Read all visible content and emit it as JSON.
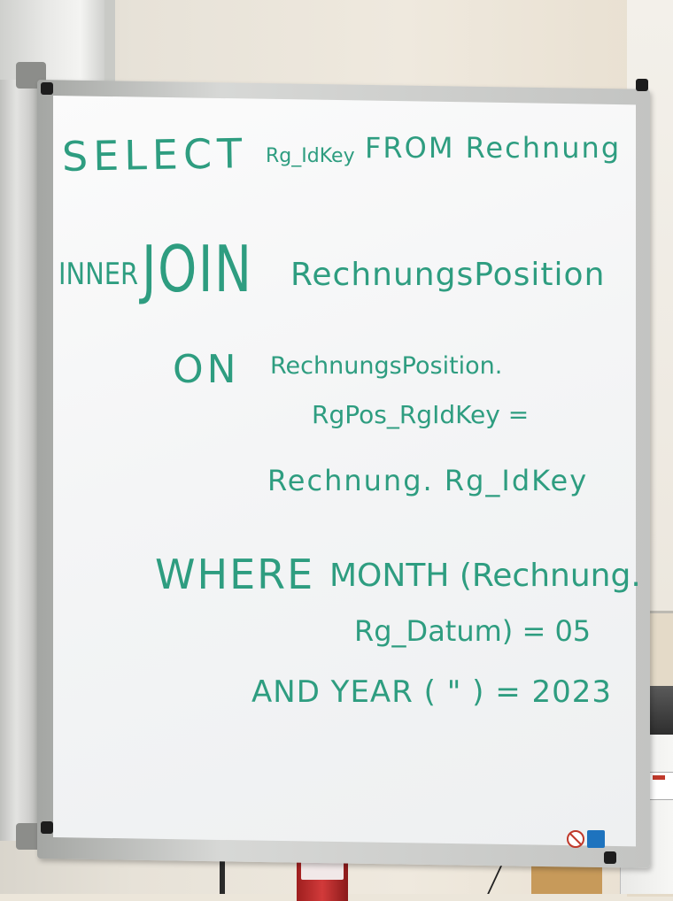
{
  "whiteboard": {
    "ink_color": "#2e9d80",
    "lines": {
      "select_keyword": "SELECT",
      "select_column": "Rg_IdKey",
      "from_clause": "FROM Rechnung",
      "inner_keyword": "INNER",
      "join_keyword": "JOIN",
      "join_table": "RechnungsPosition",
      "on_keyword": "ON",
      "on_left_1": "RechnungsPosition.",
      "on_left_2": "RgPos_RgIdKey =",
      "on_right": "Rechnung. Rg_IdKey",
      "where_keyword": "WHERE",
      "where_func": "MONTH (Rechnung.",
      "where_arg": "Rg_Datum) = 05",
      "and_clause": "AND YEAR ( \" ) = 2023"
    }
  },
  "stickers": [
    {
      "icon": "no-symbol-icon"
    },
    {
      "icon": "info-sign-icon"
    }
  ]
}
